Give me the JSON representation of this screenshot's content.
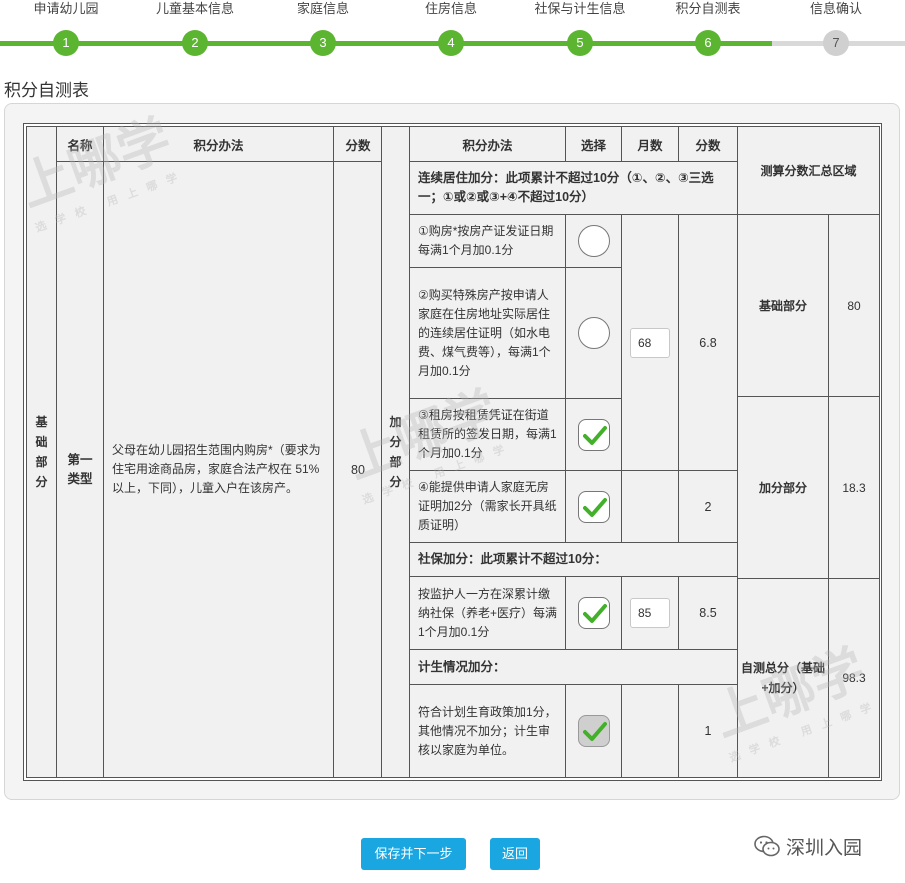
{
  "stepper": {
    "steps": [
      {
        "label": "申请幼儿园",
        "num": "1",
        "state": "done"
      },
      {
        "label": "儿童基本信息",
        "num": "2",
        "state": "done"
      },
      {
        "label": "家庭信息",
        "num": "3",
        "state": "done"
      },
      {
        "label": "住房信息",
        "num": "4",
        "state": "done"
      },
      {
        "label": "社保与计生信息",
        "num": "5",
        "state": "done"
      },
      {
        "label": "积分自测表",
        "num": "6",
        "state": "current"
      },
      {
        "label": "信息确认",
        "num": "7",
        "state": "pending"
      }
    ]
  },
  "section_title": "积分自测表",
  "base": {
    "group": "基础部分",
    "header": {
      "name": "名称",
      "method": "积分办法",
      "score": "分数"
    },
    "type": "第一类型",
    "method": "父母在幼儿园招生范围内购房*（要求为住宅用途商品房，家庭合法产权在 51%以上，下同），儿童入户在该房产。",
    "score": "80"
  },
  "bonus": {
    "group": "加分部分",
    "header": {
      "method": "积分办法",
      "select": "选择",
      "months": "月数",
      "score": "分数"
    },
    "residence_title": "连续居住加分：此项累计不超过10分（①、②、③三选一；①或②或③+④不超过10分）",
    "items": [
      {
        "text": "①购房*按房产证发证日期每满1个月加0.1分",
        "control": "radio",
        "checked": false
      },
      {
        "text": "②购买特殊房产按申请人家庭在住房地址实际居住的连续居住证明（如水电费、煤气费等），每满1个月加0.1分",
        "control": "radio",
        "checked": false
      },
      {
        "text": "③租房按租赁凭证在街道租赁所的签发日期，每满1个月加0.1分",
        "control": "check",
        "checked": true
      },
      {
        "text": "④能提供申请人家庭无房证明加2分（需家长开具纸质证明）",
        "control": "check",
        "checked": true
      }
    ],
    "residence_months": "68",
    "residence_score": "6.8",
    "no_house_score": "2",
    "social_title": "社保加分：此项累计不超过10分：",
    "social_text": "按监护人一方在深累计缴纳社保（养老+医疗）每满1个月加0.1分",
    "social_months": "85",
    "social_score": "8.5",
    "family_title": "计生情况加分：",
    "family_text": "符合计划生育政策加1分，其他情况不加分；计生审核以家庭为单位。",
    "family_score": "1"
  },
  "summary": {
    "title": "测算分数汇总区域",
    "rows": [
      {
        "label": "基础部分",
        "value": "80"
      },
      {
        "label": "加分部分",
        "value": "18.3"
      },
      {
        "label": "自测总分（基础+加分）",
        "value": "98.3"
      }
    ]
  },
  "buttons": {
    "save": "保存并下一步",
    "back": "返回"
  },
  "brand": "深圳入园",
  "watermark": {
    "big": "上哪学",
    "small": "选学校 用上哪学"
  },
  "colors": {
    "done": "#5cb531",
    "pending": "#d0d0d0",
    "button": "#1aa6e0",
    "check": "#43b02a"
  }
}
